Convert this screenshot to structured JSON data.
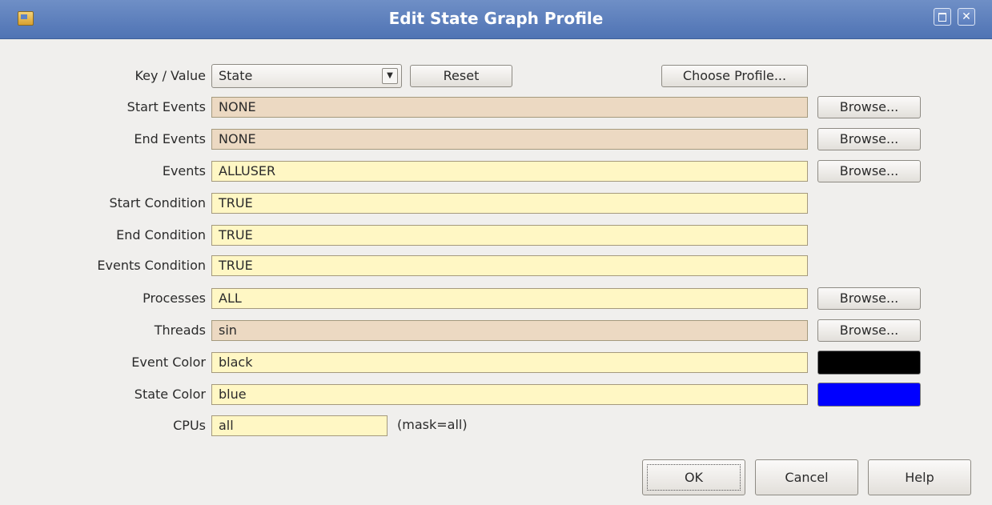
{
  "window": {
    "title": "Edit State Graph Profile"
  },
  "key_value": {
    "label": "Key / Value",
    "selected": "State",
    "reset_label": "Reset",
    "choose_profile_label": "Choose Profile..."
  },
  "fields": {
    "start_events": {
      "label": "Start Events",
      "value": "NONE"
    },
    "end_events": {
      "label": "End Events",
      "value": "NONE"
    },
    "events": {
      "label": "Events",
      "value": "ALLUSER"
    },
    "start_condition": {
      "label": "Start Condition",
      "value": "TRUE"
    },
    "end_condition": {
      "label": "End Condition",
      "value": "TRUE"
    },
    "events_condition": {
      "label": "Events Condition",
      "value": "TRUE"
    },
    "processes": {
      "label": "Processes",
      "value": "ALL"
    },
    "threads": {
      "label": "Threads",
      "value": "sin"
    },
    "event_color": {
      "label": "Event Color",
      "value": "black",
      "swatch": "#000000"
    },
    "state_color": {
      "label": "State Color",
      "value": "blue",
      "swatch": "#0000ff"
    },
    "cpus": {
      "label": "CPUs",
      "value": "all",
      "mask_text": "(mask=all)"
    }
  },
  "browse_label": "Browse...",
  "buttons": {
    "ok": "OK",
    "cancel": "Cancel",
    "help": "Help"
  },
  "colors": {
    "editable_field": "#fff7c4",
    "readonly_field": "#ecd9c2",
    "titlebar": "#5a7dbd"
  }
}
